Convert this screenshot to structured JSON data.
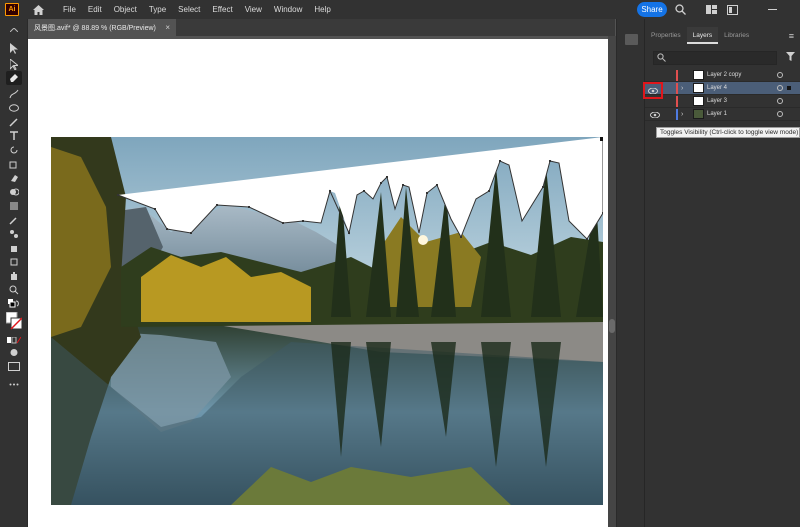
{
  "app": {
    "logo": "Ai"
  },
  "menu": [
    "File",
    "Edit",
    "Object",
    "Type",
    "Select",
    "Effect",
    "View",
    "Window",
    "Help"
  ],
  "share_label": "Share",
  "document": {
    "tab_title": "风景图.avif* @ 88.89 % (RGB/Preview)",
    "close": "×"
  },
  "panel": {
    "tabs": [
      "Properties",
      "Layers",
      "Libraries"
    ],
    "search_placeholder": "",
    "layers": [
      {
        "name": "Layer 2 copy",
        "visible": false,
        "expandable": false,
        "selected": false,
        "color": "#e04f4f"
      },
      {
        "name": "Layer 4",
        "visible": false,
        "expandable": true,
        "selected": true,
        "color": "#e04f4f"
      },
      {
        "name": "Layer 3",
        "visible": false,
        "expandable": false,
        "selected": false,
        "color": "#e04f4f"
      },
      {
        "name": "Layer 1",
        "visible": true,
        "expandable": true,
        "selected": false,
        "color": "#4f7be0"
      }
    ]
  },
  "tooltip": "Toggles Visibility (Ctrl-click to toggle view mode)",
  "colors": {
    "accent": "#1473e6",
    "highlight": "#e0161b",
    "selected_row": "#4b5e78"
  },
  "icons": [
    "home-icon",
    "search-icon",
    "arrange-icon",
    "frame-icon",
    "minimize-icon",
    "eye-icon",
    "filter-icon"
  ]
}
